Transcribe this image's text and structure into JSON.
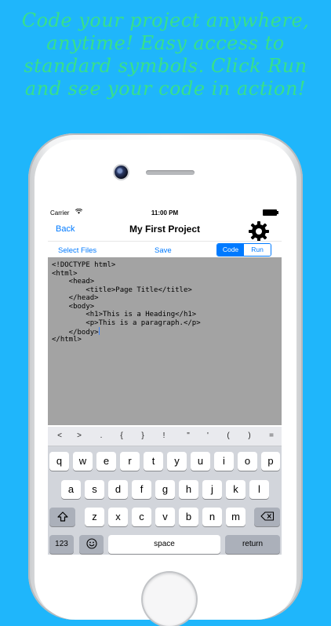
{
  "headline": {
    "line1": "Code your project anywhere,",
    "line2": "anytime! Easy access to",
    "line3": "standard symbols. Click Run",
    "line4": "and see your code in action!"
  },
  "status_bar": {
    "carrier": "Carrier",
    "time": "11:00 PM"
  },
  "nav": {
    "back_label": "Back",
    "title": "My First Project"
  },
  "toolbar": {
    "select_files_label": "Select Files",
    "save_label": "Save",
    "code_label": "Code",
    "run_label": "Run",
    "active_segment": "Code"
  },
  "editor": {
    "lines": [
      "<!DOCTYPE html>",
      "<html>",
      "    <head>",
      "        <title>Page Title</title>",
      "    </head>",
      "    <body>",
      "        <h1>This is a Heading</h1>",
      "        <p>This is a paragraph.</p>",
      "    </body>",
      "</html>"
    ]
  },
  "keyboard": {
    "symbols": [
      "<",
      ">",
      ".",
      "{",
      "}",
      "!",
      "\"",
      "'",
      "(",
      ")",
      "="
    ],
    "row1": [
      "q",
      "w",
      "e",
      "r",
      "t",
      "y",
      "u",
      "i",
      "o",
      "p"
    ],
    "row2": [
      "a",
      "s",
      "d",
      "f",
      "g",
      "h",
      "j",
      "k",
      "l"
    ],
    "row3": [
      "z",
      "x",
      "c",
      "v",
      "b",
      "n",
      "m"
    ],
    "numbers_label": "123",
    "space_label": "space",
    "return_label": "return"
  }
}
